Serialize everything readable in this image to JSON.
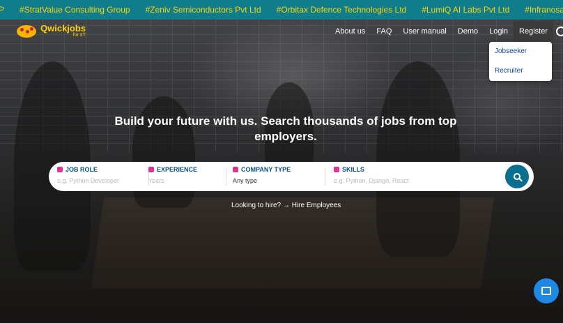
{
  "ticker": [
    "P",
    "#StratValue Consulting Group",
    "#Zeniv Semiconductors Pvt Ltd",
    "#Orbitax Defence Technologies Ltd",
    "#LumiQ AI Labs Pvt Ltd",
    "#Infranosa En"
  ],
  "brand": {
    "name": "Qwickjobs",
    "sub": "for IIT"
  },
  "nav": {
    "about": "About us",
    "faq": "FAQ",
    "manual": "User manual",
    "demo": "Demo",
    "login": "Login",
    "register": "Register"
  },
  "register_menu": [
    "Jobseeker",
    "Recruiter"
  ],
  "headline": "Build your future with us. Search thousands of jobs from top employers.",
  "search": {
    "job_role": {
      "label": "JOB ROLE",
      "placeholder": "e.g. Python Developer"
    },
    "experience": {
      "label": "EXPERIENCE",
      "placeholder": "Years"
    },
    "company_type": {
      "label": "COMPANY TYPE",
      "value": "Any type"
    },
    "skills": {
      "label": "SKILLS",
      "placeholder": "e.g. Python, Django, React"
    }
  },
  "hire_text": "Looking to hire? → Hire Employees",
  "colors": {
    "ticker_bg": "#0f7d8b",
    "ticker_text": "#ffd400",
    "accent": "#0a6e8f",
    "chat": "#1e88e5"
  }
}
